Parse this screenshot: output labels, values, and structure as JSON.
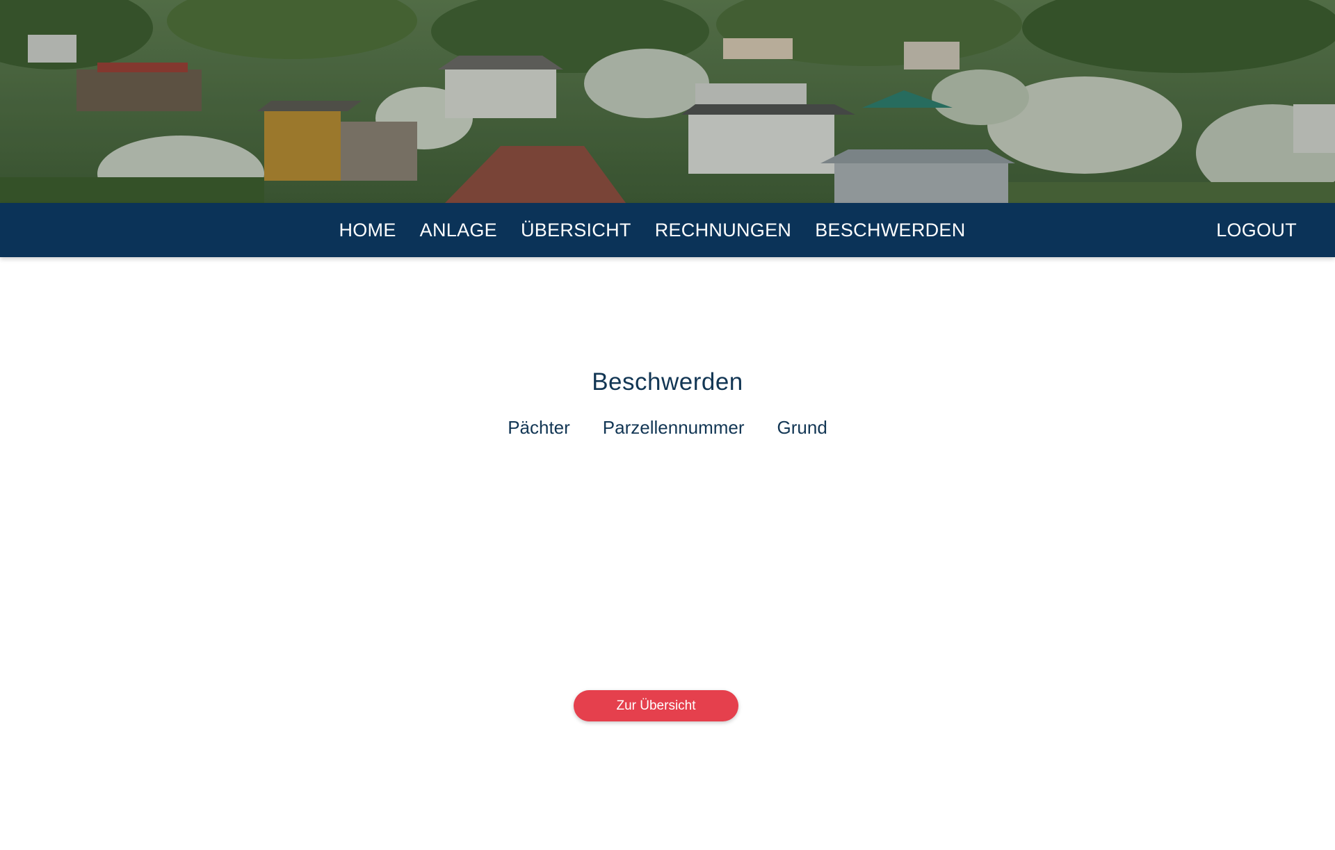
{
  "nav": {
    "items": [
      {
        "label": "HOME"
      },
      {
        "label": "ANLAGE"
      },
      {
        "label": "ÜBERSICHT"
      },
      {
        "label": "RECHNUNGEN"
      },
      {
        "label": "BESCHWERDEN"
      }
    ],
    "logout_label": "LOGOUT"
  },
  "main": {
    "title": "Beschwerden",
    "columns": [
      "Pächter",
      "Parzellennummer",
      "Grund"
    ],
    "back_button_label": "Zur Übersicht"
  },
  "colors": {
    "nav_background": "#0b3358",
    "heading_text": "#123654",
    "button_background": "#e5404d",
    "page_background": "#ffffff"
  }
}
